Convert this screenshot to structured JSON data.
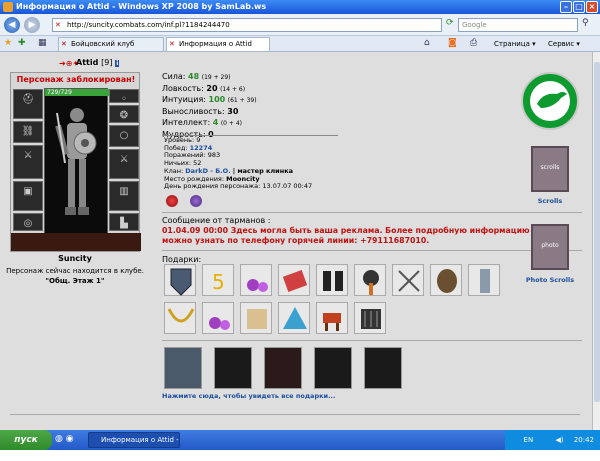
{
  "window": {
    "title": "Информация о Attid - Windows XP 2008 by SamLab.ws"
  },
  "addressbar": {
    "url": "http://suncity.combats.com/inf.pl?1184244470",
    "search_placeholder": "Google"
  },
  "tabs": [
    {
      "label": "Бойцовский клуб"
    },
    {
      "label": "Информация о Attid"
    }
  ],
  "toolbar": {
    "page_label": "Страница",
    "service_label": "Сервис"
  },
  "character": {
    "blocked_text": "Персонаж заблокирован!",
    "name": "Attid",
    "level": "[9]",
    "info_icon": "i",
    "hp_text": "729/729",
    "hp_fraction": 1.0,
    "city": "Suncity",
    "location_line": "Персонаж сейчас находится в клубе.",
    "location_room": "\"Общ. Этаж 1\""
  },
  "stats": [
    {
      "label": "Сила:",
      "value": "48",
      "bonus": "(19 + 29)"
    },
    {
      "label": "Ловкость:",
      "value": "20",
      "bonus": "(14 + 6)"
    },
    {
      "label": "Интуиция:",
      "value": "100",
      "bonus": "(61 + 39)"
    },
    {
      "label": "Выносливость:",
      "value": "30",
      "bonus": ""
    },
    {
      "label": "Интеллект:",
      "value": "4",
      "bonus": "(0 + 4)"
    },
    {
      "label": "Мудрость:",
      "value": "0",
      "bonus": ""
    }
  ],
  "info": {
    "level": "Уровень: 9",
    "wins_label": "Побед:",
    "wins": "12274",
    "losses": "Поражений: 983",
    "draws": "Ничьих: 52",
    "clan_label": "Клан:",
    "clan": "DarkD - Б.О.",
    "clan_rank": "| мастер клинка",
    "birthplace_label": "Место рождения:",
    "birthplace": "Mooncity",
    "birthday": "День рождения персонажа: 13.07.07 00:47"
  },
  "message": {
    "title": "Сообщение от тарманов :",
    "text": "01.04.09 00:00 Здесь могла быть ваша реклама. Более подробную информацию можно узнать по телефону горячей линии: +79111687010."
  },
  "gifts": {
    "title": "Подарки:",
    "link": "Нажмите сюда, чтобы увидеть все подарки..."
  },
  "right": {
    "scrolls_label": "Scrolls",
    "photo_label": "Photo Scrolls",
    "banner1_text": "scrolls",
    "banner2_text": "photo"
  },
  "taskbar": {
    "start_label": "пуск",
    "task_label": "Информация о Attid - ...",
    "lang": "EN",
    "time": "20:42"
  }
}
